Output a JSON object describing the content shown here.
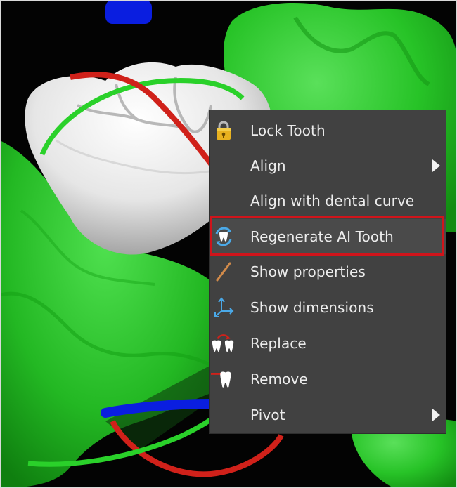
{
  "scene": {
    "background_color": "#030303",
    "gum_color": "#26c026",
    "tooth_color": "#e8e8e8",
    "gizmo_colors": {
      "x_axis": "#d0211a",
      "y_axis": "#2ad12a",
      "z_axis": "#0a1ee0"
    }
  },
  "context_menu": {
    "background": "#414141",
    "highlight_border_color": "#d0141b",
    "items": [
      {
        "label": "Lock Tooth",
        "icon": "lock-icon",
        "submenu": false
      },
      {
        "label": "Align",
        "icon": "",
        "submenu": true
      },
      {
        "label": "Align with dental curve",
        "icon": "",
        "submenu": false
      },
      {
        "label": "Regenerate AI Tooth",
        "icon": "regenerate-ai-tooth-icon",
        "submenu": false,
        "highlighted": true
      },
      {
        "label": "Show properties",
        "icon": "properties-pencil-icon",
        "submenu": false
      },
      {
        "label": "Show dimensions",
        "icon": "dimensions-axes-icon",
        "submenu": false
      },
      {
        "label": "Replace",
        "icon": "replace-teeth-icon",
        "submenu": false
      },
      {
        "label": "Remove",
        "icon": "remove-tooth-icon",
        "submenu": false
      },
      {
        "label": "Pivot",
        "icon": "",
        "submenu": true
      }
    ]
  }
}
